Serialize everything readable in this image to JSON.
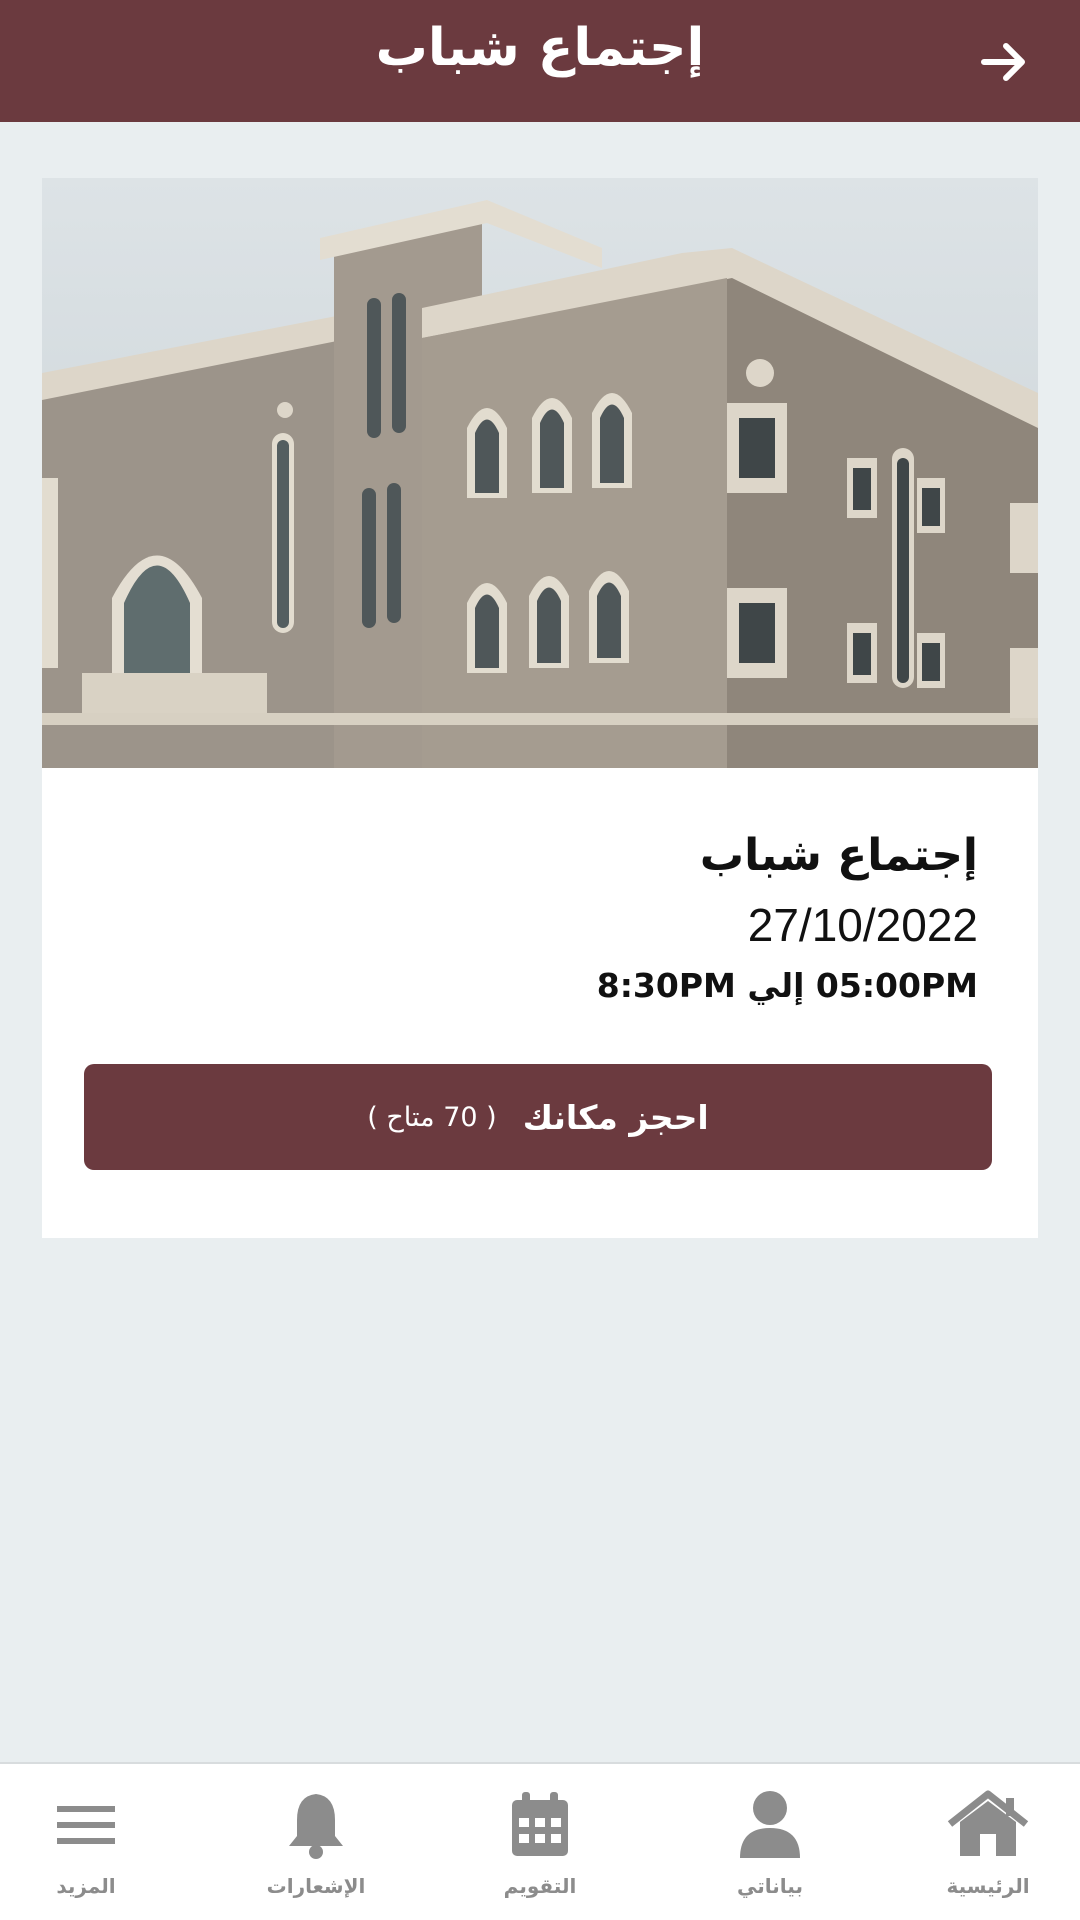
{
  "header": {
    "title": "إجتماع شباب",
    "back_icon": "arrow-right-icon"
  },
  "event": {
    "title": "إجتماع شباب",
    "date": "27/10/2022",
    "time": "05:00PM إلي 8:30PM",
    "book_label": "احجز مكانك",
    "availability": "( 70 متاح )"
  },
  "tabs": [
    {
      "label": "الرئيسية",
      "icon": "home-icon"
    },
    {
      "label": "بياناتي",
      "icon": "user-icon"
    },
    {
      "label": "التقويم",
      "icon": "calendar-icon"
    },
    {
      "label": "الإشعارات",
      "icon": "bell-icon"
    },
    {
      "label": "المزيد",
      "icon": "menu-icon"
    }
  ],
  "colors": {
    "primary": "#6b3a3f",
    "background": "#e9eef0",
    "tab_inactive": "#8c8c8c"
  }
}
